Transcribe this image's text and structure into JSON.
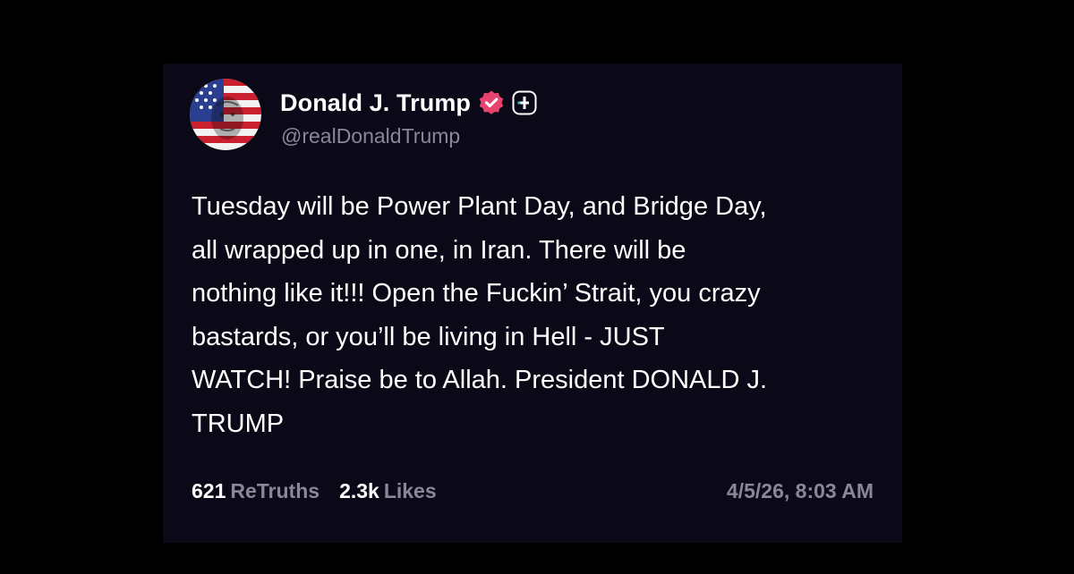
{
  "post": {
    "author": {
      "display_name": "Donald J. Trump",
      "handle": "@realDonaldTrump",
      "avatar_icon": "flag-portrait-avatar",
      "verified_icon": "verified-badge-icon",
      "plus_icon": "plus-badge-icon"
    },
    "text": "Tuesday will be Power Plant Day, and Bridge Day,\nall wrapped up in one, in Iran. There will be\nnothing like it!!! Open the Fuckin’ Strait, you crazy\nbastards, or you’ll be living in Hell - JUST\nWATCH! Praise be to Allah. President DONALD J.\nTRUMP",
    "stats": {
      "retruths_count": "621",
      "retruths_label": "ReTruths",
      "likes_count": "2.3k",
      "likes_label": "Likes"
    },
    "timestamp": "4/5/26, 8:03 AM"
  },
  "colors": {
    "page_background": "#000000",
    "card_background": "#0b0818",
    "primary_text": "#ffffff",
    "secondary_text": "#8a8798",
    "verified_badge": "#e8436f"
  }
}
